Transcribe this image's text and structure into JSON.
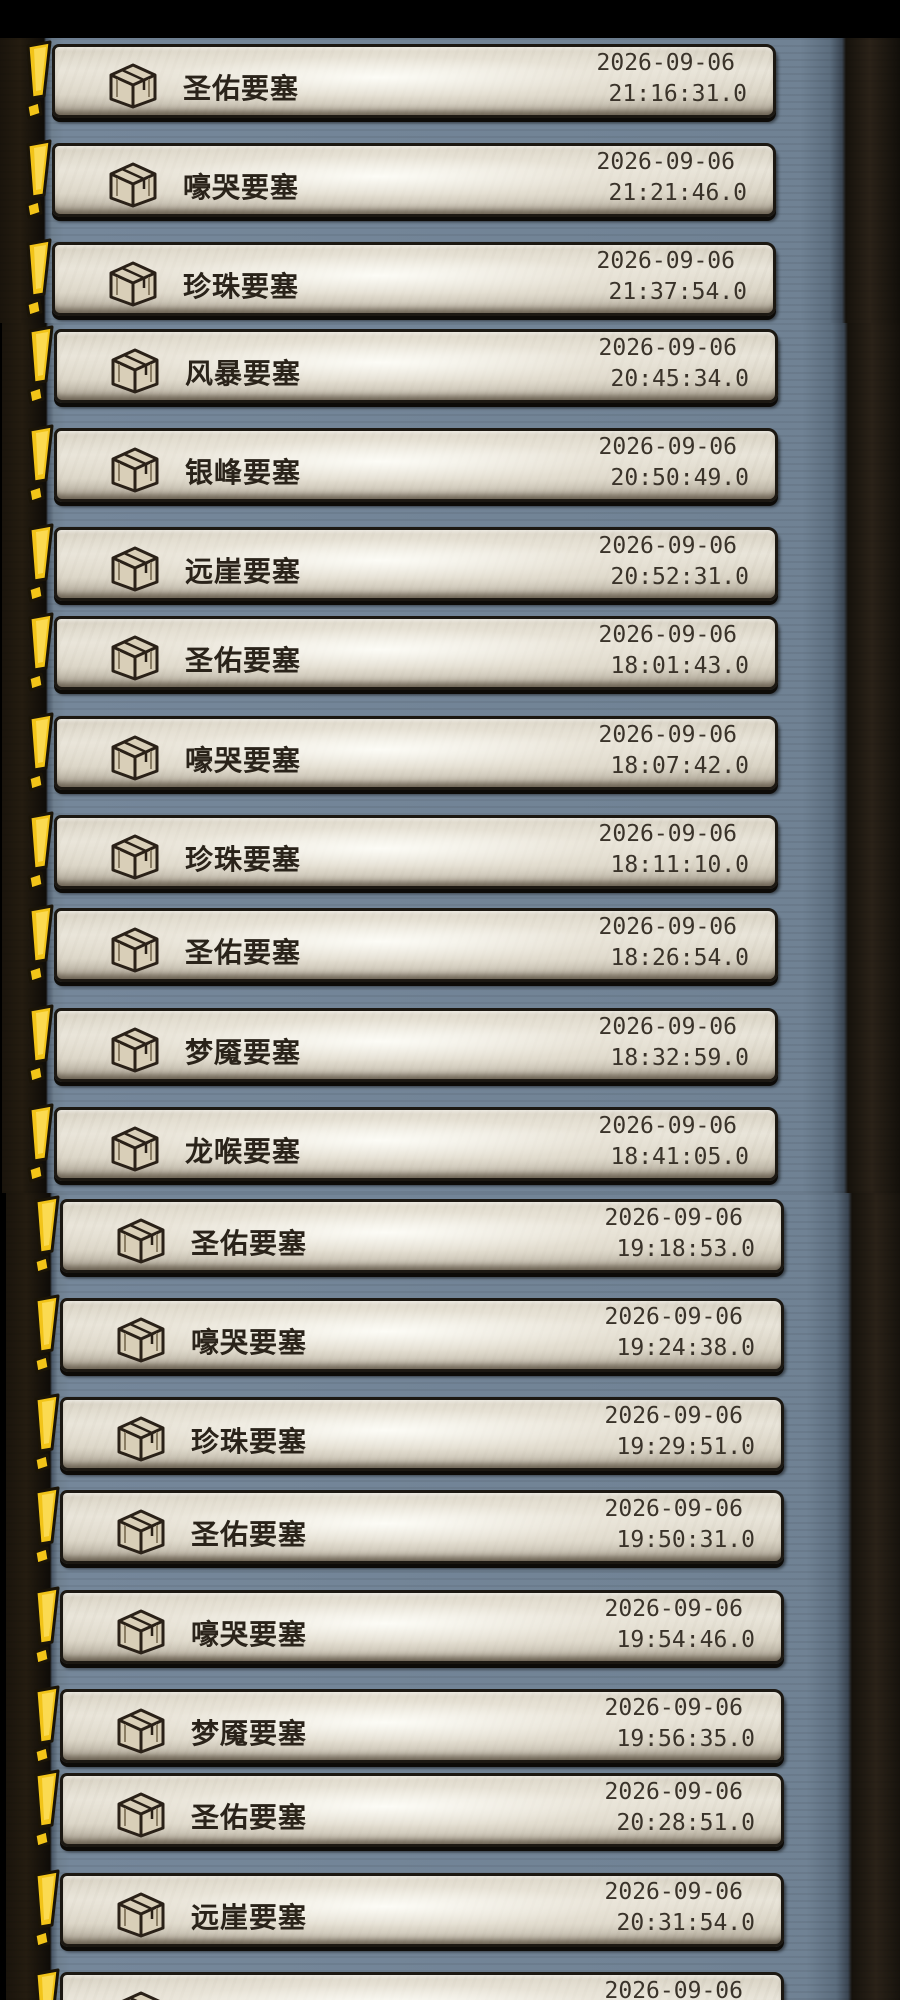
{
  "entries": [
    {
      "name": "圣佑要塞",
      "date": "2026-09-06",
      "time": "21:16:31.0"
    },
    {
      "name": "嚎哭要塞",
      "date": "2026-09-06",
      "time": "21:21:46.0"
    },
    {
      "name": "珍珠要塞",
      "date": "2026-09-06",
      "time": "21:37:54.0"
    },
    {
      "name": "风暴要塞",
      "date": "2026-09-06",
      "time": "20:45:34.0"
    },
    {
      "name": "银峰要塞",
      "date": "2026-09-06",
      "time": "20:50:49.0"
    },
    {
      "name": "远崖要塞",
      "date": "2026-09-06",
      "time": "20:52:31.0"
    },
    {
      "name": "圣佑要塞",
      "date": "2026-09-06",
      "time": "18:01:43.0"
    },
    {
      "name": "嚎哭要塞",
      "date": "2026-09-06",
      "time": "18:07:42.0"
    },
    {
      "name": "珍珠要塞",
      "date": "2026-09-06",
      "time": "18:11:10.0"
    },
    {
      "name": "圣佑要塞",
      "date": "2026-09-06",
      "time": "18:26:54.0"
    },
    {
      "name": "梦魇要塞",
      "date": "2026-09-06",
      "time": "18:32:59.0"
    },
    {
      "name": "龙喉要塞",
      "date": "2026-09-06",
      "time": "18:41:05.0"
    },
    {
      "name": "圣佑要塞",
      "date": "2026-09-06",
      "time": "19:18:53.0"
    },
    {
      "name": "嚎哭要塞",
      "date": "2026-09-06",
      "time": "19:24:38.0"
    },
    {
      "name": "珍珠要塞",
      "date": "2026-09-06",
      "time": "19:29:51.0"
    },
    {
      "name": "圣佑要塞",
      "date": "2026-09-06",
      "time": "19:50:31.0"
    },
    {
      "name": "嚎哭要塞",
      "date": "2026-09-06",
      "time": "19:54:46.0"
    },
    {
      "name": "梦魇要塞",
      "date": "2026-09-06",
      "time": "19:56:35.0"
    },
    {
      "name": "圣佑要塞",
      "date": "2026-09-06",
      "time": "20:28:51.0"
    },
    {
      "name": "远崖要塞",
      "date": "2026-09-06",
      "time": "20:31:54.0"
    },
    {
      "name": "",
      "date": "2026-09-06",
      "time": ""
    }
  ],
  "icons": {
    "alert": "exclamation-alert-icon",
    "chest": "treasure-chest-icon"
  },
  "colors": {
    "alert_yellow": "#f2c418",
    "plaque": "#e6e1d6",
    "text": "#2a231a",
    "frame": "#6f8090"
  }
}
